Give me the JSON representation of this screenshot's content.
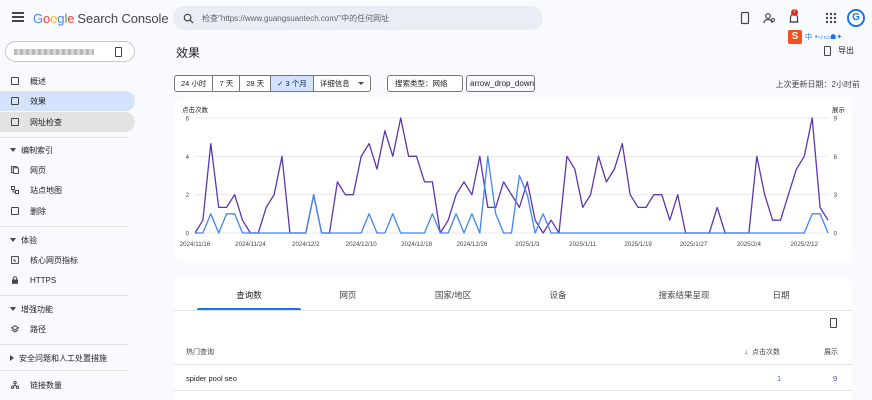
{
  "header": {
    "product": "Search Console",
    "search_placeholder": "检查\"https://www.guangsuantech.com/\"中的任何网址",
    "notification_count": "7",
    "avatar_letter": "G",
    "extension_badge": "S",
    "extension_label": "中"
  },
  "sidebar": {
    "items": [
      {
        "label": "概述"
      },
      {
        "label": "效果"
      },
      {
        "label": "网址检查"
      }
    ],
    "section_index": "编制索引",
    "index_items": [
      {
        "label": "网页"
      },
      {
        "label": "站点地图"
      },
      {
        "label": "删除"
      }
    ],
    "section_experience": "体验",
    "experience_items": [
      {
        "label": "核心网页指标"
      },
      {
        "label": "HTTPS"
      }
    ],
    "section_enhancements": "增强功能",
    "enhancement_items": [
      {
        "label": "路径"
      }
    ],
    "section_security": "安全问题和人工处置措施",
    "link_item": "链接数量"
  },
  "main": {
    "title": "效果",
    "export_label": "导出",
    "date_filters": [
      "24 小时",
      "7 天",
      "28 天",
      "✓ 3 个月",
      "详细信息"
    ],
    "search_type": "搜索类型：网络",
    "add_filter": "arrow_drop_down",
    "last_updated": "上次更新日期：2小时前"
  },
  "chart_data": {
    "type": "line",
    "left_axis_label": "点击次数",
    "right_axis_label": "展示",
    "left_ticks": [
      "6",
      "4",
      "2",
      "0"
    ],
    "right_ticks": [
      "9",
      "6",
      "3",
      "0"
    ],
    "x_ticks": [
      "2024/11/16",
      "2024/11/24",
      "2024/12/2",
      "2024/12/10",
      "2024/12/18",
      "2024/12/26",
      "2025/1/3",
      "2025/1/11",
      "2025/1/19",
      "2025/1/27",
      "2025/2/4",
      "2025/2/12"
    ],
    "ylim_left": [
      0,
      6
    ],
    "ylim_right": [
      0,
      9
    ],
    "series": [
      {
        "name": "展示",
        "axis": "right",
        "color": "#5e35b1",
        "values": [
          0,
          1,
          7,
          2,
          2,
          3,
          1,
          0,
          0,
          2,
          3,
          6,
          0,
          0,
          0,
          3,
          0,
          0,
          4,
          3,
          3,
          6,
          7,
          5,
          8,
          6,
          9,
          6,
          6,
          4,
          4,
          0,
          1,
          3,
          4,
          3,
          6,
          2,
          2,
          4,
          3,
          2,
          4,
          1,
          0,
          1,
          0,
          6,
          5,
          2,
          3,
          6,
          4,
          5,
          7,
          3,
          2,
          2,
          3,
          3,
          1,
          3,
          0,
          0,
          0,
          0,
          2,
          0,
          0,
          0,
          0,
          6,
          3,
          1,
          1,
          3,
          5,
          6,
          9,
          2,
          1
        ]
      },
      {
        "name": "点击次数",
        "axis": "left",
        "color": "#4285f4",
        "values": [
          0,
          0,
          1,
          0,
          1,
          1,
          0,
          0,
          0,
          0,
          0,
          0,
          0,
          0,
          0,
          2,
          0,
          0,
          0,
          0,
          0,
          0,
          1,
          0,
          0,
          1,
          0,
          0,
          0,
          0,
          1,
          0,
          0,
          1,
          0,
          1,
          0,
          4,
          1,
          0,
          0,
          3,
          2,
          0,
          1,
          0,
          0,
          0,
          0,
          0,
          0,
          0,
          0,
          0,
          0,
          0,
          0,
          0,
          0,
          0,
          0,
          0,
          0,
          0,
          0,
          0,
          0,
          0,
          0,
          0,
          0,
          0,
          0,
          0,
          0,
          0,
          0,
          0,
          1,
          1,
          0
        ]
      }
    ]
  },
  "table": {
    "tabs": [
      "查询数",
      "网页",
      "国家/地区",
      "设备",
      "搜索结果呈现",
      "日期"
    ],
    "columns": {
      "query": "热门查询",
      "clicks": "点击次数",
      "impressions": "展示"
    },
    "rows": [
      {
        "query": "spider pool seo",
        "clicks": "1",
        "impressions": "9"
      }
    ]
  },
  "colors": {
    "accent": "#1a73e8",
    "clicks_line": "#4285f4",
    "impressions_line": "#5e35b1",
    "active_nav": "#d3e3fd"
  }
}
